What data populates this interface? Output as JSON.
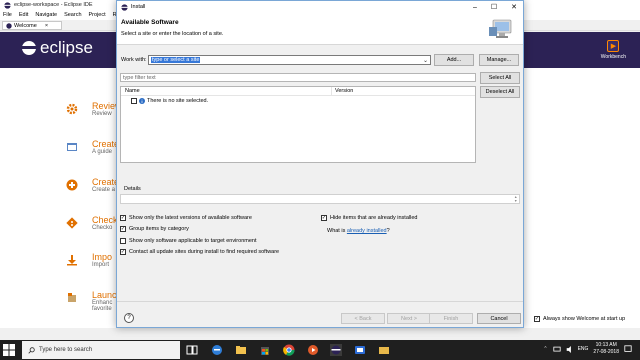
{
  "eclipse": {
    "window_title": "eclipse-workspace - Eclipse IDE",
    "menu": [
      "File",
      "Edit",
      "Navigate",
      "Search",
      "Project",
      "Ru"
    ],
    "tab_label": "Welcome",
    "logo_text": "eclipse",
    "workbench_label": "Workbench",
    "welcome_items": [
      {
        "title": "Review",
        "desc": "Review",
        "icon": "gear-icon"
      },
      {
        "title": "Create",
        "desc": "A guide",
        "icon": "project-icon"
      },
      {
        "title": "Create",
        "desc": "Create a",
        "icon": "plus-icon"
      },
      {
        "title": "Checko",
        "desc": "Checko",
        "icon": "git-icon"
      },
      {
        "title": "Impo",
        "desc": "Import",
        "icon": "import-icon"
      },
      {
        "title": "Launc",
        "desc": "Enhanc",
        "desc2": "favorite",
        "icon": "launch-icon"
      }
    ],
    "always_show_label": "Always show Welcome at start up",
    "always_show_checked": true
  },
  "dialog": {
    "title": "Install",
    "header_title": "Available Software",
    "header_subtitle": "Select a site or enter the location of a site.",
    "work_with_label": "Work with:",
    "work_with_value": "type or select a site",
    "add_button": "Add...",
    "manage_button": "Manage...",
    "filter_placeholder": "type filter text",
    "select_all_button": "Select All",
    "deselect_all_button": "Deselect All",
    "tree_columns": {
      "name": "Name",
      "version": "Version"
    },
    "tree_row_text": "There is no site selected.",
    "details_label": "Details",
    "options": {
      "show_latest": "Show only the latest versions of available software",
      "group_by_category": "Group items by category",
      "show_applicable": "Show only software applicable to target environment",
      "contact_sites": "Contact all update sites during install to find required software",
      "hide_installed": "Hide items that are already installed"
    },
    "options_checked": {
      "show_latest": true,
      "group_by_category": true,
      "show_applicable": false,
      "contact_sites": true,
      "hide_installed": true
    },
    "what_is_prefix": "What is ",
    "what_is_link": "already installed",
    "what_is_suffix": "?",
    "back_button": "< Back",
    "next_button": "Next >",
    "finish_button": "Finish",
    "cancel_button": "Cancel",
    "help_button": "?"
  },
  "taskbar": {
    "search_placeholder": "Type here to search",
    "language": "ENG",
    "time": "10:13 AM",
    "date": "27-08-2018"
  },
  "colors": {
    "eclipse_banner": "#2c2255",
    "welcome_accent": "#e07000",
    "selection": "#3778d8",
    "taskbar": "#1f1f1f"
  }
}
